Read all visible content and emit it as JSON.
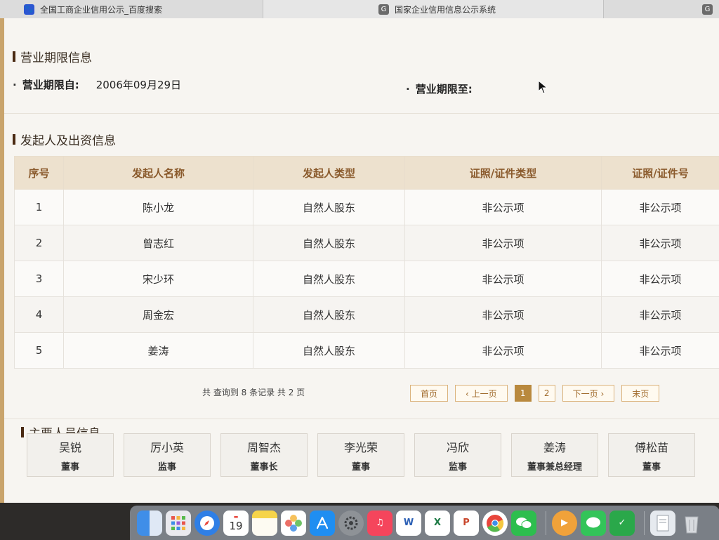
{
  "tabs": [
    {
      "label": "全国工商企业信用公示_百度搜索",
      "icon": "baidu-icon"
    },
    {
      "label": "国家企业信用信息公示系统",
      "icon": "g-site-icon",
      "favicon_letter": "G"
    },
    {
      "label": "",
      "icon": "g-site-icon",
      "favicon_letter": "G"
    }
  ],
  "business_term": {
    "title": "营业期限信息",
    "from_label": "营业期限自:",
    "from_value": "2006年09月29日",
    "to_label": "营业期限至:",
    "to_value": ""
  },
  "founders": {
    "title": "发起人及出资信息",
    "columns": [
      "序号",
      "发起人名称",
      "发起人类型",
      "证照/证件类型",
      "证照/证件号"
    ],
    "rows": [
      [
        "1",
        "陈小龙",
        "自然人股东",
        "非公示项",
        "非公示项"
      ],
      [
        "2",
        "曾志红",
        "自然人股东",
        "非公示项",
        "非公示项"
      ],
      [
        "3",
        "宋少环",
        "自然人股东",
        "非公示项",
        "非公示项"
      ],
      [
        "4",
        "周金宏",
        "自然人股东",
        "非公示项",
        "非公示项"
      ],
      [
        "5",
        "姜涛",
        "自然人股东",
        "非公示项",
        "非公示项"
      ]
    ],
    "pager_info": "共 查询到 8 条记录 共 2 页",
    "pager": {
      "first": "首页",
      "prev": "‹ 上一页",
      "pages": [
        "1",
        "2"
      ],
      "current": "1",
      "next": "下一页 ›",
      "last": "末页"
    }
  },
  "personnel": {
    "title": "主要人员信息",
    "people": [
      {
        "name": "吴锐",
        "role": "董事"
      },
      {
        "name": "厉小英",
        "role": "监事"
      },
      {
        "name": "周智杰",
        "role": "董事长"
      },
      {
        "name": "李光荣",
        "role": "董事"
      },
      {
        "name": "冯欣",
        "role": "监事"
      },
      {
        "name": "姜涛",
        "role": "董事兼总经理"
      },
      {
        "name": "傅松苗",
        "role": "董事"
      }
    ]
  },
  "dock": {
    "calendar_day": "19",
    "apps": [
      "finder",
      "launchpad",
      "safari",
      "calendar",
      "notes",
      "photos",
      "app-store",
      "system-settings",
      "music",
      "word",
      "excel",
      "powerpoint",
      "chrome",
      "wechat",
      "infuse",
      "messages",
      "security",
      "preview",
      "trash"
    ],
    "word_letter": "W",
    "excel_letter": "X",
    "ppt_letter": "P"
  },
  "colors": {
    "accent": "#b9893e",
    "header_bg": "#ede1ce",
    "header_text": "#8a5a2c",
    "title_bar": "#4a2a12"
  }
}
